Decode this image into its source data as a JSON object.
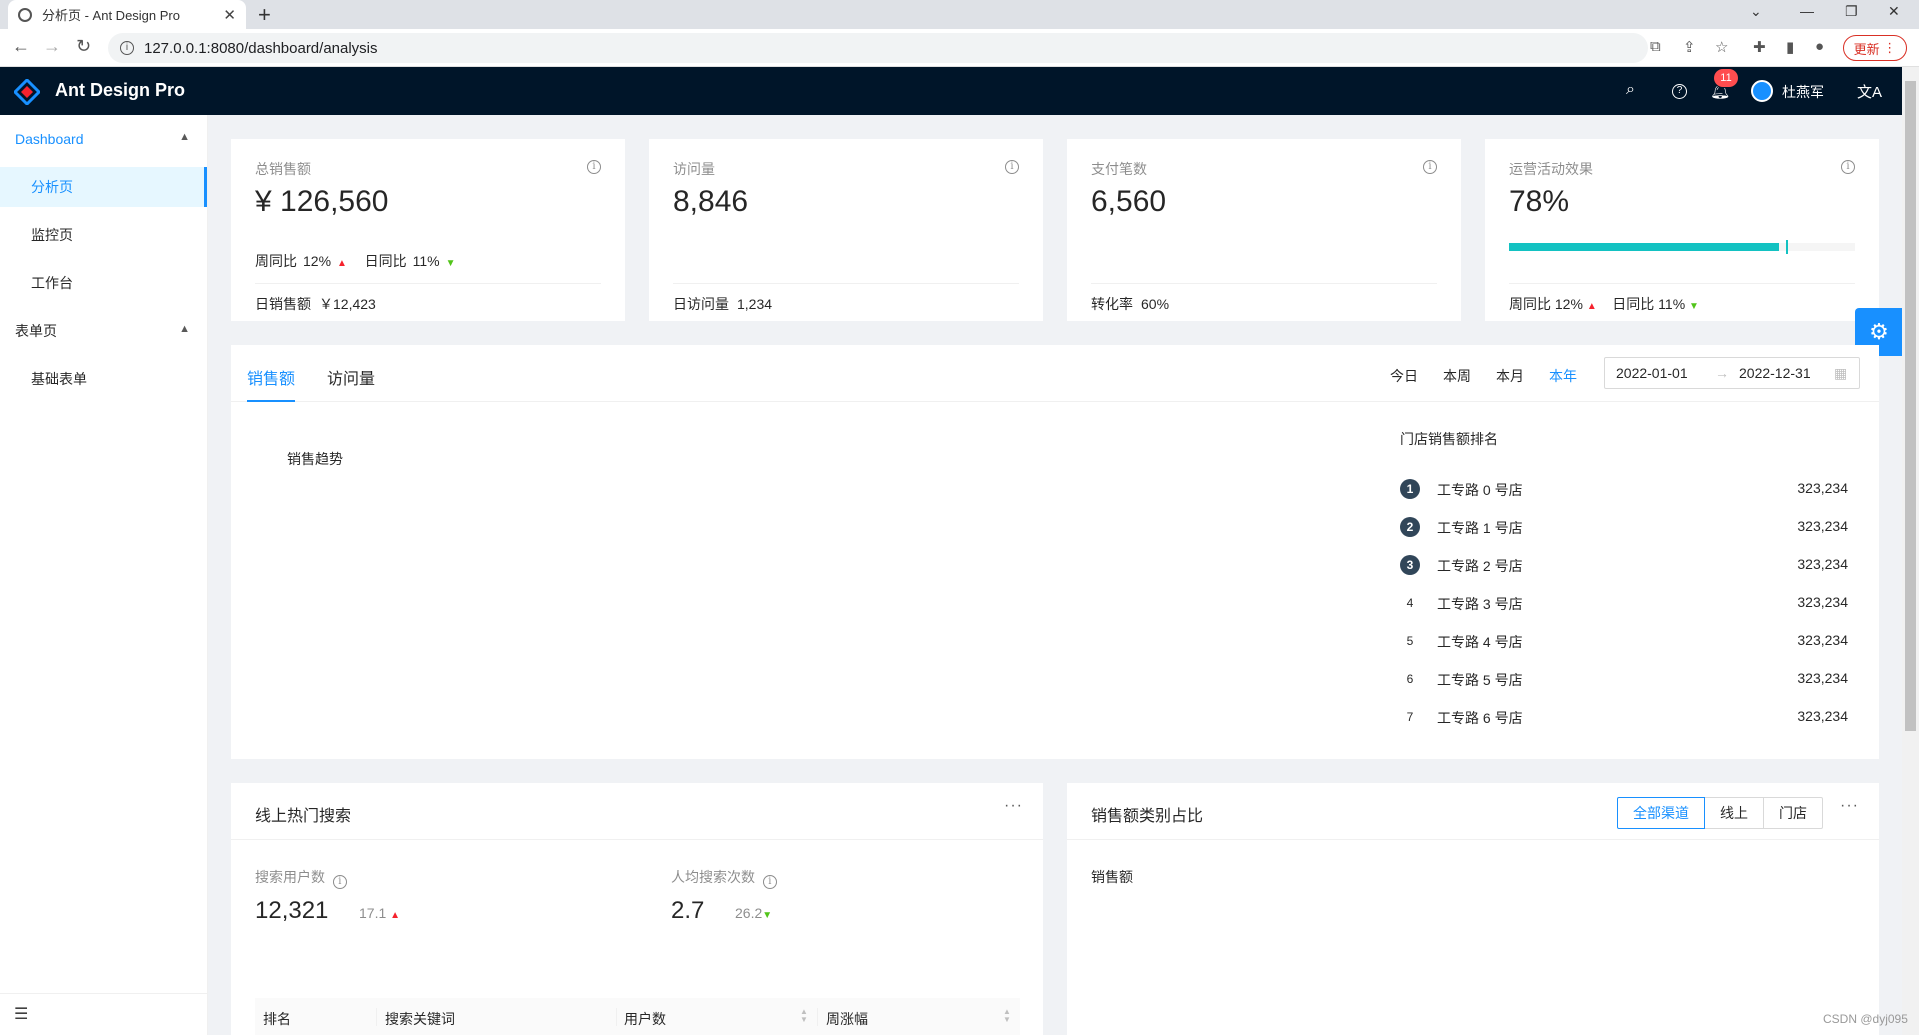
{
  "browser": {
    "tab_title": "分析页 - Ant Design Pro",
    "url": "127.0.0.1:8080/dashboard/analysis",
    "update_label": "更新"
  },
  "header": {
    "brand": "Ant Design Pro",
    "notification_count": "11",
    "username": "杜燕军"
  },
  "sidebar": {
    "groups": [
      {
        "label": "Dashboard",
        "items": [
          "分析页",
          "监控页",
          "工作台"
        ]
      },
      {
        "label": "表单页",
        "items": [
          "基础表单"
        ]
      }
    ]
  },
  "stats": [
    {
      "title": "总销售额",
      "value": "¥ 126,560",
      "trend": {
        "week_label": "周同比",
        "week": "12%",
        "day_label": "日同比",
        "day": "11%"
      },
      "footer_label": "日销售额",
      "footer_value": "￥12,423"
    },
    {
      "title": "访问量",
      "value": "8,846",
      "footer_label": "日访问量",
      "footer_value": "1,234"
    },
    {
      "title": "支付笔数",
      "value": "6,560",
      "footer_label": "转化率",
      "footer_value": "60%"
    },
    {
      "title": "运营活动效果",
      "value": "78%",
      "progress": 0.78,
      "target": 0.8,
      "trend": {
        "week_label": "周同比",
        "week": "12%",
        "day_label": "日同比",
        "day": "11%"
      }
    }
  ],
  "sales": {
    "tabs": [
      "销售额",
      "访问量"
    ],
    "ranges": [
      "今日",
      "本周",
      "本月",
      "本年"
    ],
    "date_start": "2022-01-01",
    "date_end": "2022-12-31",
    "chart_title": "销售趋势",
    "ranking_title": "门店销售额排名",
    "ranking": [
      {
        "rank": "1",
        "name": "工专路 0 号店",
        "value": "323,234"
      },
      {
        "rank": "2",
        "name": "工专路 1 号店",
        "value": "323,234"
      },
      {
        "rank": "3",
        "name": "工专路 2 号店",
        "value": "323,234"
      },
      {
        "rank": "4",
        "name": "工专路 3 号店",
        "value": "323,234"
      },
      {
        "rank": "5",
        "name": "工专路 4 号店",
        "value": "323,234"
      },
      {
        "rank": "6",
        "name": "工专路 5 号店",
        "value": "323,234"
      },
      {
        "rank": "7",
        "name": "工专路 6 号店",
        "value": "323,234"
      }
    ]
  },
  "search": {
    "title": "线上热门搜索",
    "users_label": "搜索用户数",
    "users_value": "12,321",
    "users_sub": "17.1",
    "avg_label": "人均搜索次数",
    "avg_value": "2.7",
    "avg_sub": "26.2",
    "columns": [
      "排名",
      "搜索关键词",
      "用户数",
      "周涨幅"
    ]
  },
  "category": {
    "title": "销售额类别占比",
    "channels": [
      "全部渠道",
      "线上",
      "门店"
    ],
    "pie_title": "销售额"
  },
  "watermark": "CSDN @dyj095",
  "colors": {
    "primary": "#1890ff",
    "header": "#001529",
    "progress": "#13c2c2",
    "up": "#f5222d",
    "down": "#52c41a"
  }
}
